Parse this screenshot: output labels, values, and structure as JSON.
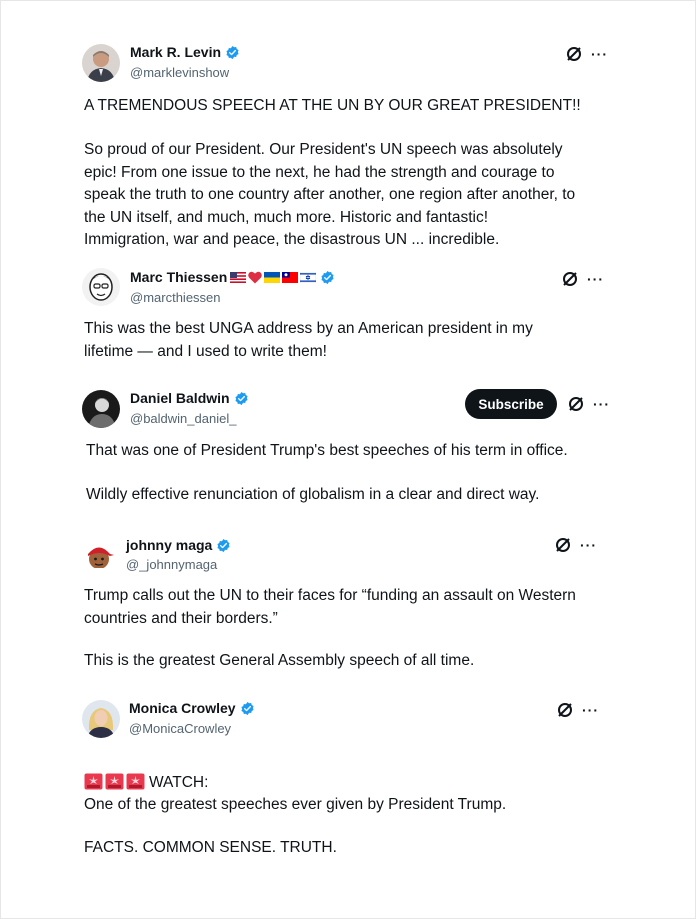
{
  "posts": [
    {
      "name": "Mark R. Levin",
      "handle": "@marklevinshow",
      "avatar_icon": "man-headshot-avatar",
      "verified": true,
      "paragraphs": [
        "A TREMENDOUS SPEECH AT THE UN BY OUR GREAT PRESIDENT!!",
        "So proud of our President.  Our President's UN speech was absolutely\nepic!  From one issue to the next, he had the strength and courage to\nspeak the truth to one country after another, one region after another, to\nthe UN itself, and much, much more.  Historic and fantastic!\nImmigration, war and peace, the disastrous UN ... incredible."
      ]
    },
    {
      "name": "Marc Thiessen",
      "handle": "@marcthiessen",
      "avatar_icon": "cartoon-face-avatar",
      "verified": true,
      "name_emojis": [
        "us-flag-icon",
        "red-heart-icon",
        "ukraine-flag-icon",
        "taiwan-flag-icon",
        "israel-flag-icon"
      ],
      "paragraphs": [
        "This was the best UNGA address by an American president in my\nlifetime — and I used to write them!"
      ]
    },
    {
      "name": "Daniel Baldwin",
      "handle": "@baldwin_daniel_",
      "avatar_icon": "portrait-avatar",
      "verified": true,
      "subscribe_label": "Subscribe",
      "paragraphs": [
        "That was one of President Trump's best speeches of his term in office.",
        "Wildly effective renunciation of globalism in a clear and direct way."
      ]
    },
    {
      "name": "johnny maga",
      "handle": "@_johnnymaga",
      "avatar_icon": "red-cap-emoji-avatar",
      "verified": true,
      "paragraphs": [
        "Trump calls out the UN to their faces for “funding an assault on Western\ncountries and their borders.”",
        "This is the greatest General Assembly speech of all time."
      ]
    },
    {
      "name": "Monica Crowley",
      "handle": "@MonicaCrowley",
      "avatar_icon": "woman-headshot-avatar",
      "verified": true,
      "lead_emojis": [
        "siren-icon",
        "siren-icon",
        "siren-icon"
      ],
      "paragraphs": [
        "WATCH:",
        "One of the greatest speeches ever given by President Trump.",
        "FACTS. COMMON SENSE. TRUTH."
      ]
    }
  ],
  "more_label": "···",
  "colors": {
    "verified": "#1d9bf0",
    "text": "#0f1419",
    "secondary": "#536471",
    "subscribe_bg": "#0f1419"
  }
}
